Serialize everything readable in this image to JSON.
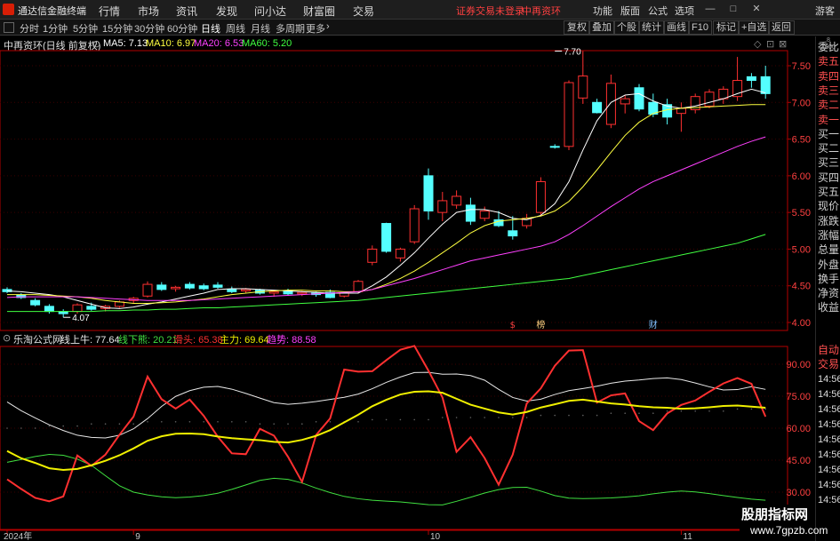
{
  "app": {
    "title": "通达信金融终端",
    "menus": [
      "行情",
      "市场",
      "资讯",
      "发现",
      "问小达",
      "财富圈",
      "交易"
    ],
    "notice": "证券交易未登录",
    "notice_stock": "中再资环",
    "right_menus": [
      "功能",
      "版面",
      "公式",
      "选项"
    ],
    "guest": "游客"
  },
  "toolbar": {
    "periods": [
      "分时",
      "1分钟",
      "5分钟",
      "15分钟",
      "30分钟",
      "60分钟",
      "日线",
      "周线",
      "月线",
      "多周期",
      "更多"
    ],
    "active_period": "日线",
    "tools": [
      "复权",
      "叠加",
      "个股",
      "统计",
      "画线",
      "F10",
      "标记",
      "+自选",
      "返回"
    ]
  },
  "main": {
    "title": "中再资环(日线 前复权)",
    "ma": [
      {
        "label": "MA5: 7.13",
        "color": "#ffffff"
      },
      {
        "label": "MA10: 6.97",
        "color": "#ffff40"
      },
      {
        "label": "MA20: 6.53",
        "color": "#ff40ff"
      },
      {
        "label": "MA60: 5.20",
        "color": "#40ff40"
      }
    ]
  },
  "indicator": {
    "name": "乐淘公式网",
    "values": [
      {
        "label": "线上牛: 77.64",
        "color": "#e8e8e8"
      },
      {
        "label": "线下熊: 20.21",
        "color": "#40e040"
      },
      {
        "label": "滑头: 65.38",
        "color": "#ff3030"
      },
      {
        "label": "主力: 69.64",
        "color": "#f0f000"
      },
      {
        "label": "趋势: 88.58",
        "color": "#ff40ff"
      }
    ]
  },
  "sidebar": {
    "top": "8\n1000",
    "items": [
      "委比",
      "卖五",
      "卖四",
      "卖三",
      "卖二",
      "卖一",
      "买一",
      "买二",
      "买三",
      "买四",
      "买五",
      "现价",
      "涨跌",
      "涨幅",
      "总量",
      "外盘",
      "换手",
      "净资",
      "收益"
    ],
    "red_items": [
      "卖五",
      "卖四",
      "卖三",
      "卖二",
      "卖一"
    ],
    "trade": [
      "自动",
      "交易"
    ],
    "times": [
      "14:56",
      "14:56",
      "14:56",
      "14:56",
      "14:56",
      "14:56",
      "14:56",
      "14:56",
      "14:56"
    ]
  },
  "watermark": {
    "line1": "股朋指标网",
    "line2": "www.7gpzb.com"
  },
  "colors": {
    "up": "#ff3030",
    "down": "#54ffff",
    "axis": "#b40000",
    "grid": "#3a0000"
  },
  "chart_data": [
    {
      "type": "candlestick",
      "title": "中再资环(日线 前复权)",
      "y_ticks": [
        4.0,
        4.5,
        5.0,
        5.5,
        6.0,
        6.5,
        7.0,
        7.5
      ],
      "ylim": [
        3.95,
        7.75
      ],
      "annotations": [
        {
          "text": "7.70",
          "index": 39,
          "value": 7.7
        },
        {
          "text": "4.07",
          "index": 4,
          "value": 4.07
        }
      ],
      "markers": [
        {
          "text": "$",
          "index": 36,
          "color": "#ff4040"
        },
        {
          "text": "榜",
          "index": 38,
          "color": "#ffd080"
        },
        {
          "text": "财",
          "index": 46,
          "color": "#80c0ff"
        }
      ],
      "x_labels": [
        {
          "index": 0,
          "text": "2024年"
        },
        {
          "index": 9,
          "text": "9"
        },
        {
          "index": 30,
          "text": "10"
        },
        {
          "index": 48,
          "text": "11"
        }
      ],
      "candles": [
        {
          "o": 4.45,
          "h": 4.48,
          "l": 4.4,
          "c": 4.42
        },
        {
          "o": 4.37,
          "h": 4.4,
          "l": 4.32,
          "c": 4.34
        },
        {
          "o": 4.3,
          "h": 4.33,
          "l": 4.22,
          "c": 4.24
        },
        {
          "o": 4.22,
          "h": 4.25,
          "l": 4.12,
          "c": 4.15
        },
        {
          "o": 4.15,
          "h": 4.18,
          "l": 4.07,
          "c": 4.12
        },
        {
          "o": 4.15,
          "h": 4.26,
          "l": 4.12,
          "c": 4.24
        },
        {
          "o": 4.22,
          "h": 4.27,
          "l": 4.16,
          "c": 4.18
        },
        {
          "o": 4.19,
          "h": 4.24,
          "l": 4.15,
          "c": 4.22
        },
        {
          "o": 4.22,
          "h": 4.3,
          "l": 4.2,
          "c": 4.28
        },
        {
          "o": 4.3,
          "h": 4.35,
          "l": 4.26,
          "c": 4.33
        },
        {
          "o": 4.36,
          "h": 4.56,
          "l": 4.34,
          "c": 4.52
        },
        {
          "o": 4.51,
          "h": 4.55,
          "l": 4.43,
          "c": 4.45
        },
        {
          "o": 4.46,
          "h": 4.5,
          "l": 4.42,
          "c": 4.48
        },
        {
          "o": 4.52,
          "h": 4.55,
          "l": 4.45,
          "c": 4.47
        },
        {
          "o": 4.5,
          "h": 4.53,
          "l": 4.44,
          "c": 4.46
        },
        {
          "o": 4.51,
          "h": 4.55,
          "l": 4.46,
          "c": 4.48
        },
        {
          "o": 4.45,
          "h": 4.49,
          "l": 4.4,
          "c": 4.42
        },
        {
          "o": 4.43,
          "h": 4.47,
          "l": 4.4,
          "c": 4.45
        },
        {
          "o": 4.44,
          "h": 4.46,
          "l": 4.38,
          "c": 4.4
        },
        {
          "o": 4.4,
          "h": 4.44,
          "l": 4.35,
          "c": 4.42
        },
        {
          "o": 4.43,
          "h": 4.46,
          "l": 4.37,
          "c": 4.39
        },
        {
          "o": 4.39,
          "h": 4.43,
          "l": 4.36,
          "c": 4.41
        },
        {
          "o": 4.4,
          "h": 4.42,
          "l": 4.35,
          "c": 4.38
        },
        {
          "o": 4.41,
          "h": 4.45,
          "l": 4.33,
          "c": 4.34
        },
        {
          "o": 4.36,
          "h": 4.42,
          "l": 4.34,
          "c": 4.4
        },
        {
          "o": 4.42,
          "h": 4.58,
          "l": 4.4,
          "c": 4.56
        },
        {
          "o": 4.82,
          "h": 5.05,
          "l": 4.78,
          "c": 5.0
        },
        {
          "o": 5.35,
          "h": 5.36,
          "l": 4.95,
          "c": 4.97
        },
        {
          "o": 4.88,
          "h": 5.02,
          "l": 4.83,
          "c": 5.0
        },
        {
          "o": 5.1,
          "h": 5.6,
          "l": 5.07,
          "c": 5.55
        },
        {
          "o": 6.0,
          "h": 6.1,
          "l": 5.4,
          "c": 5.52
        },
        {
          "o": 5.5,
          "h": 5.78,
          "l": 5.38,
          "c": 5.66
        },
        {
          "o": 5.6,
          "h": 5.8,
          "l": 5.55,
          "c": 5.72
        },
        {
          "o": 5.6,
          "h": 5.7,
          "l": 5.33,
          "c": 5.38
        },
        {
          "o": 5.42,
          "h": 5.58,
          "l": 5.38,
          "c": 5.52
        },
        {
          "o": 5.4,
          "h": 5.52,
          "l": 5.3,
          "c": 5.32
        },
        {
          "o": 5.25,
          "h": 5.45,
          "l": 5.13,
          "c": 5.18
        },
        {
          "o": 5.32,
          "h": 5.48,
          "l": 5.28,
          "c": 5.42
        },
        {
          "o": 5.5,
          "h": 5.98,
          "l": 5.46,
          "c": 5.92
        },
        {
          "o": 6.4,
          "h": 6.43,
          "l": 6.37,
          "c": 6.39
        },
        {
          "o": 6.4,
          "h": 7.3,
          "l": 6.35,
          "c": 7.27
        },
        {
          "o": 7.06,
          "h": 7.7,
          "l": 6.98,
          "c": 7.36
        },
        {
          "o": 7.0,
          "h": 7.05,
          "l": 6.85,
          "c": 6.86
        },
        {
          "o": 6.7,
          "h": 7.38,
          "l": 6.65,
          "c": 7.26
        },
        {
          "o": 6.98,
          "h": 7.1,
          "l": 6.85,
          "c": 7.05
        },
        {
          "o": 7.2,
          "h": 7.25,
          "l": 6.88,
          "c": 6.91
        },
        {
          "o": 7.0,
          "h": 7.12,
          "l": 6.8,
          "c": 6.84
        },
        {
          "o": 6.97,
          "h": 7.05,
          "l": 6.7,
          "c": 6.8
        },
        {
          "o": 6.85,
          "h": 7.0,
          "l": 6.6,
          "c": 6.92
        },
        {
          "o": 6.9,
          "h": 7.12,
          "l": 6.85,
          "c": 7.08
        },
        {
          "o": 6.95,
          "h": 7.18,
          "l": 6.92,
          "c": 7.14
        },
        {
          "o": 7.05,
          "h": 7.22,
          "l": 6.98,
          "c": 7.18
        },
        {
          "o": 7.08,
          "h": 7.62,
          "l": 7.02,
          "c": 7.3
        },
        {
          "o": 7.35,
          "h": 7.4,
          "l": 7.2,
          "c": 7.3
        },
        {
          "o": 7.35,
          "h": 7.5,
          "l": 7.05,
          "c": 7.12
        }
      ],
      "series": [
        {
          "name": "MA5",
          "color": "#ffffff",
          "values": [
            4.43,
            4.42,
            4.4,
            4.38,
            4.35,
            4.3,
            4.25,
            4.2,
            4.19,
            4.21,
            4.25,
            4.28,
            4.32,
            4.36,
            4.4,
            4.45,
            4.46,
            4.46,
            4.45,
            4.44,
            4.43,
            4.42,
            4.41,
            4.4,
            4.4,
            4.4,
            4.5,
            4.62,
            4.78,
            4.95,
            5.15,
            5.34,
            5.5,
            5.54,
            5.54,
            5.5,
            5.42,
            5.4,
            5.46,
            5.62,
            5.92,
            6.35,
            6.75,
            7.0,
            7.1,
            7.12,
            7.02,
            6.95,
            6.92,
            6.95,
            7.0,
            7.05,
            7.12,
            7.18,
            7.13
          ]
        },
        {
          "name": "MA10",
          "color": "#ffff40",
          "values": [
            4.38,
            4.38,
            4.38,
            4.37,
            4.36,
            4.35,
            4.33,
            4.3,
            4.28,
            4.26,
            4.26,
            4.27,
            4.28,
            4.3,
            4.32,
            4.35,
            4.38,
            4.4,
            4.42,
            4.43,
            4.44,
            4.44,
            4.43,
            4.43,
            4.42,
            4.42,
            4.45,
            4.52,
            4.6,
            4.7,
            4.82,
            4.95,
            5.08,
            5.22,
            5.32,
            5.38,
            5.4,
            5.42,
            5.45,
            5.52,
            5.65,
            5.85,
            6.08,
            6.32,
            6.55,
            6.73,
            6.85,
            6.9,
            6.92,
            6.93,
            6.94,
            6.95,
            6.96,
            6.97,
            6.97
          ]
        },
        {
          "name": "MA20",
          "color": "#ff40ff",
          "values": [
            4.34,
            4.35,
            4.35,
            4.35,
            4.35,
            4.35,
            4.34,
            4.33,
            4.32,
            4.31,
            4.3,
            4.3,
            4.3,
            4.3,
            4.31,
            4.32,
            4.33,
            4.34,
            4.35,
            4.36,
            4.37,
            4.38,
            4.39,
            4.4,
            4.41,
            4.42,
            4.45,
            4.5,
            4.55,
            4.6,
            4.66,
            4.72,
            4.78,
            4.84,
            4.88,
            4.92,
            4.96,
            5.0,
            5.04,
            5.1,
            5.2,
            5.32,
            5.45,
            5.58,
            5.7,
            5.82,
            5.92,
            6.0,
            6.08,
            6.16,
            6.24,
            6.32,
            6.4,
            6.47,
            6.53
          ]
        },
        {
          "name": "MA60",
          "color": "#40ff40",
          "values": [
            4.15,
            4.15,
            4.15,
            4.15,
            4.15,
            4.15,
            4.15,
            4.16,
            4.16,
            4.17,
            4.17,
            4.18,
            4.18,
            4.19,
            4.2,
            4.2,
            4.21,
            4.22,
            4.23,
            4.24,
            4.25,
            4.26,
            4.27,
            4.28,
            4.29,
            4.3,
            4.32,
            4.34,
            4.36,
            4.38,
            4.4,
            4.42,
            4.44,
            4.46,
            4.48,
            4.5,
            4.52,
            4.54,
            4.56,
            4.58,
            4.6,
            4.64,
            4.68,
            4.72,
            4.76,
            4.8,
            4.84,
            4.88,
            4.92,
            4.96,
            5.0,
            5.04,
            5.08,
            5.14,
            5.2
          ]
        }
      ]
    },
    {
      "type": "line",
      "title": "乐淘公式网",
      "y_ticks": [
        30.0,
        45.0,
        60.0,
        75.0,
        90.0
      ],
      "ylim": [
        25,
        102
      ],
      "series": [
        {
          "name": "线上牛",
          "color": "#e8e8e8",
          "values": [
            72.3,
            68.2,
            64.8,
            61.6,
            58.9,
            56.7,
            55.7,
            55.4,
            56.7,
            59.7,
            64.5,
            70.2,
            74.9,
            77.6,
            79.2,
            79.6,
            78.3,
            76.3,
            74.1,
            72.0,
            71.2,
            71.7,
            72.5,
            73.5,
            74.5,
            76.0,
            78.5,
            81.5,
            84.0,
            86.1,
            86.2,
            85.3,
            85.4,
            84.7,
            82.5,
            78.2,
            74.4,
            72.7,
            73.6,
            75.8,
            77.6,
            78.6,
            79.7,
            81.1,
            82.1,
            82.6,
            83.3,
            83.6,
            82.8,
            81.2,
            79.4,
            77.9,
            78.1,
            79.5,
            78.2
          ]
        },
        {
          "name": "线下熊",
          "color": "#40e040",
          "values": [
            44.0,
            45.3,
            46.7,
            47.7,
            47.3,
            45.5,
            42.6,
            37.7,
            33.0,
            30.0,
            28.7,
            27.8,
            27.4,
            27.7,
            28.4,
            29.5,
            31.3,
            33.4,
            35.5,
            36.5,
            36.0,
            34.3,
            31.9,
            29.8,
            28.0,
            26.9,
            26.2,
            25.8,
            25.4,
            24.8,
            24.1,
            24.0,
            25.7,
            27.6,
            29.6,
            31.2,
            32.2,
            32.3,
            30.5,
            28.4,
            27.2,
            27.0,
            27.1,
            27.3,
            27.7,
            28.3,
            29.2,
            30.0,
            30.5,
            30.1,
            29.3,
            28.4,
            27.5,
            26.7,
            26.2
          ]
        },
        {
          "name": "滑头",
          "color": "#ff3030",
          "values": [
            36.0,
            31.5,
            27.3,
            25.7,
            28.0,
            47.2,
            42.3,
            47.6,
            56.9,
            65.4,
            84.2,
            73.6,
            69.2,
            73.4,
            65.8,
            56.0,
            48.2,
            47.8,
            59.7,
            56.5,
            46.6,
            34.8,
            56.8,
            64.6,
            87.5,
            86.5,
            86.7,
            91.9,
            96.8,
            98.6,
            87.0,
            74.4,
            48.9,
            55.8,
            46.0,
            33.5,
            47.6,
            71.6,
            78.7,
            89.3,
            96.4,
            96.6,
            72.0,
            75.4,
            76.3,
            63.3,
            59.1,
            66.9,
            70.9,
            73.0,
            77.1,
            81.0,
            83.5,
            80.8,
            65.4
          ]
        },
        {
          "name": "主力",
          "color": "#f0f000",
          "values": [
            49.3,
            45.9,
            43.7,
            41.2,
            40.4,
            40.9,
            42.6,
            44.7,
            47.3,
            50.5,
            54.1,
            56.2,
            57.4,
            57.5,
            57.2,
            56.1,
            55.3,
            54.8,
            54.4,
            53.6,
            53.3,
            54.5,
            56.4,
            59.1,
            62.7,
            66.3,
            70.3,
            73.3,
            75.8,
            77.1,
            77.3,
            76.6,
            73.8,
            71.0,
            69.2,
            67.4,
            66.4,
            67.6,
            69.7,
            71.2,
            72.8,
            73.4,
            72.5,
            71.6,
            71.1,
            70.3,
            69.8,
            69.6,
            69.1,
            69.3,
            69.8,
            70.4,
            70.6,
            70.1,
            69.6
          ]
        }
      ],
      "dots": {
        "color": "#606060",
        "values": [
          60,
          60,
          60,
          61,
          61,
          61,
          62,
          62,
          62,
          62,
          63,
          63,
          63,
          63,
          63,
          63,
          63,
          63,
          62,
          62,
          62,
          62,
          63,
          63,
          63,
          63,
          64,
          64,
          64,
          64,
          64,
          65,
          65,
          65,
          65,
          65,
          65,
          65,
          66,
          66,
          66,
          66,
          66,
          67,
          67,
          67,
          67,
          68,
          68,
          68,
          68,
          68,
          69,
          69,
          69
        ]
      }
    }
  ]
}
